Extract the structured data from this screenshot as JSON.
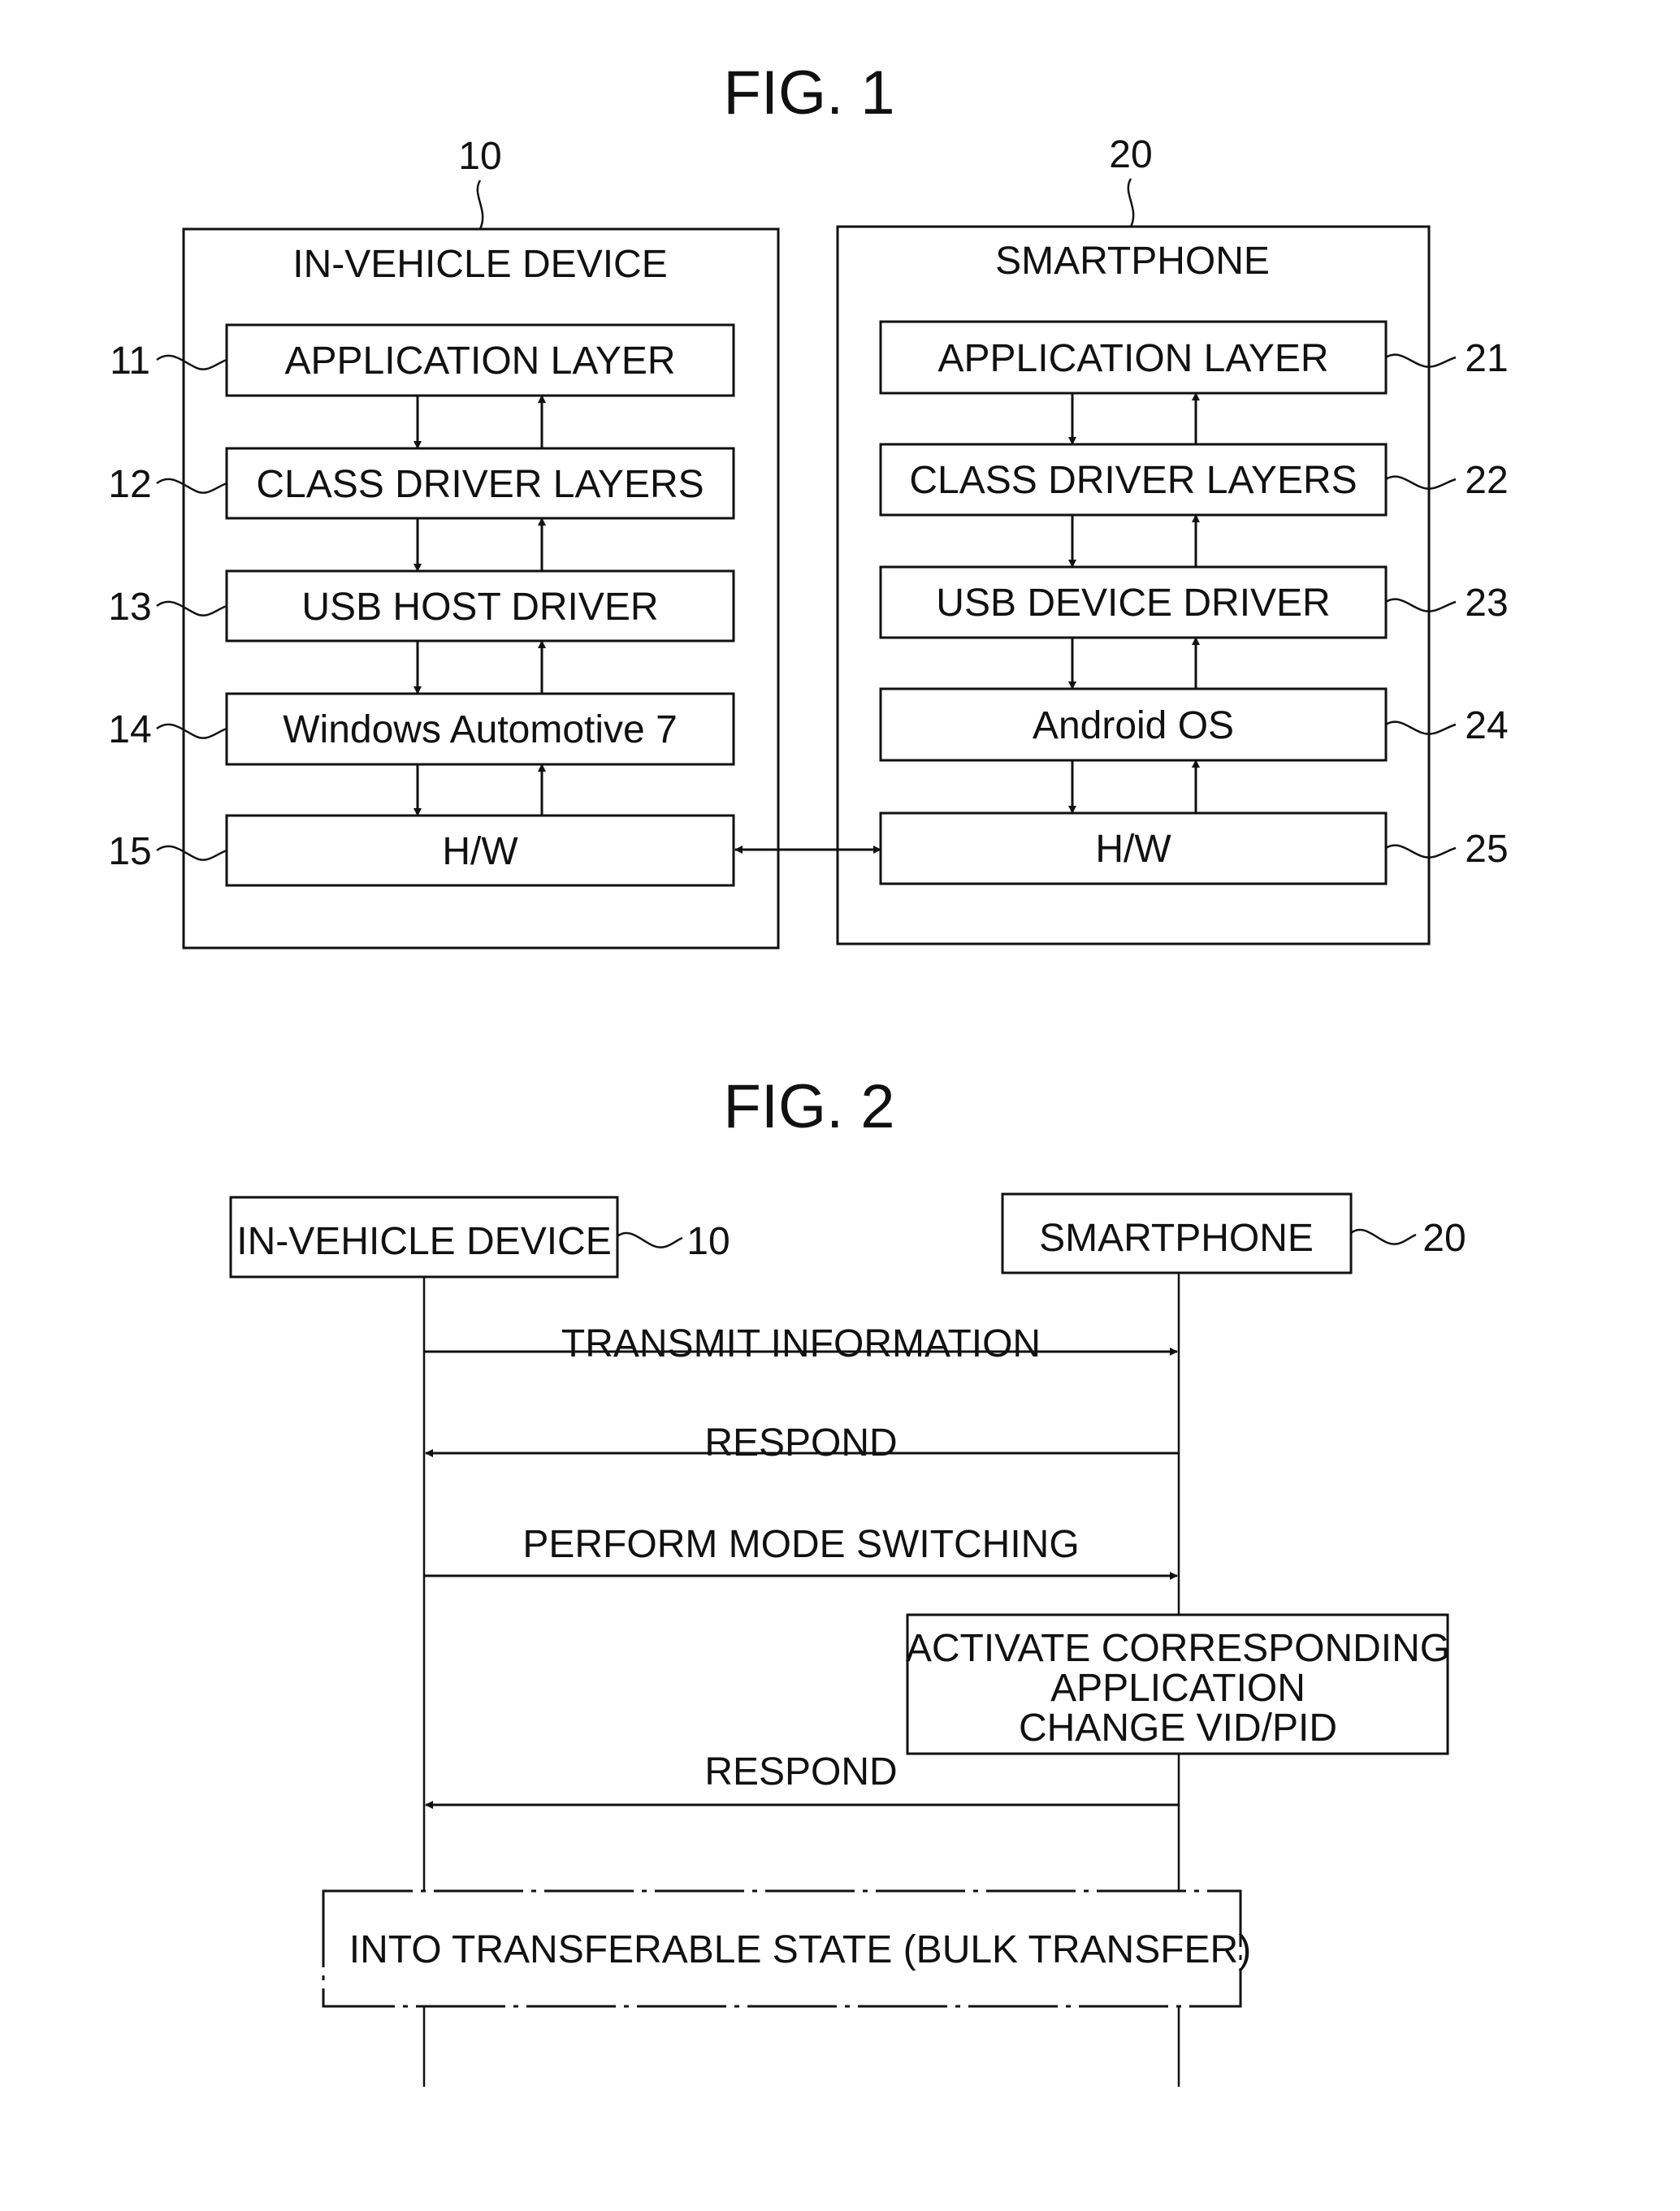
{
  "fig1": {
    "title": "FIG. 1",
    "left_device": {
      "ref": "10",
      "title": "IN-VEHICLE DEVICE",
      "layers": [
        {
          "ref": "11",
          "label": "APPLICATION LAYER"
        },
        {
          "ref": "12",
          "label": "CLASS DRIVER LAYERS"
        },
        {
          "ref": "13",
          "label": "USB HOST DRIVER"
        },
        {
          "ref": "14",
          "label": "Windows Automotive 7"
        },
        {
          "ref": "15",
          "label": "H/W"
        }
      ]
    },
    "right_device": {
      "ref": "20",
      "title": "SMARTPHONE",
      "layers": [
        {
          "ref": "21",
          "label": "APPLICATION LAYER"
        },
        {
          "ref": "22",
          "label": "CLASS DRIVER LAYERS"
        },
        {
          "ref": "23",
          "label": "USB DEVICE DRIVER"
        },
        {
          "ref": "24",
          "label": "Android OS"
        },
        {
          "ref": "25",
          "label": "H/W"
        }
      ]
    }
  },
  "fig2": {
    "title": "FIG. 2",
    "participants": [
      {
        "label": "IN-VEHICLE DEVICE",
        "ref": "10"
      },
      {
        "label": "SMARTPHONE",
        "ref": "20"
      }
    ],
    "messages": [
      {
        "label": "TRANSMIT INFORMATION",
        "direction": "right"
      },
      {
        "label": "RESPOND",
        "direction": "left"
      },
      {
        "label": "PERFORM MODE SWITCHING",
        "direction": "right"
      },
      {
        "label": "RESPOND",
        "direction": "left"
      }
    ],
    "activation": {
      "lines": [
        "ACTIVATE CORRESPONDING",
        "APPLICATION",
        "CHANGE VID/PID"
      ]
    },
    "state_box": "INTO TRANSFERABLE STATE (BULK TRANSFER)"
  }
}
